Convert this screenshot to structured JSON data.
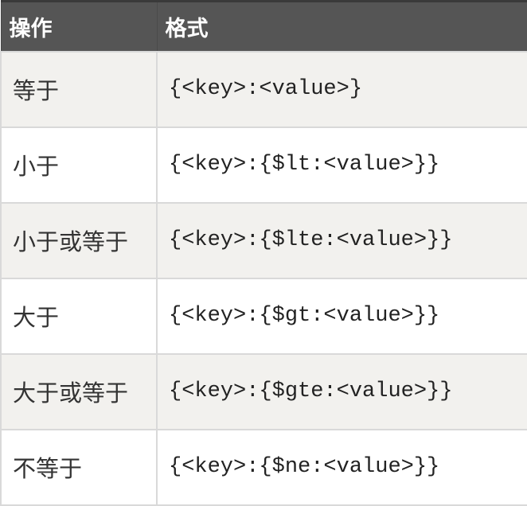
{
  "table": {
    "headers": [
      "操作",
      "格式"
    ],
    "rows": [
      {
        "op": "等于",
        "fmt": "{<key>:<value>}"
      },
      {
        "op": "小于",
        "fmt": "{<key>:{$lt:<value>}}"
      },
      {
        "op": "小于或等于",
        "fmt": "{<key>:{$lte:<value>}}"
      },
      {
        "op": "大于",
        "fmt": "{<key>:{$gt:<value>}}"
      },
      {
        "op": "大于或等于",
        "fmt": "{<key>:{$gte:<value>}}"
      },
      {
        "op": "不等于",
        "fmt": "{<key>:{$ne:<value>}}"
      }
    ]
  },
  "colors": {
    "header_bg": "#555555",
    "row_alt_bg": "#f2f1ee",
    "row_bg": "#ffffff",
    "border": "#d9d9d9"
  }
}
